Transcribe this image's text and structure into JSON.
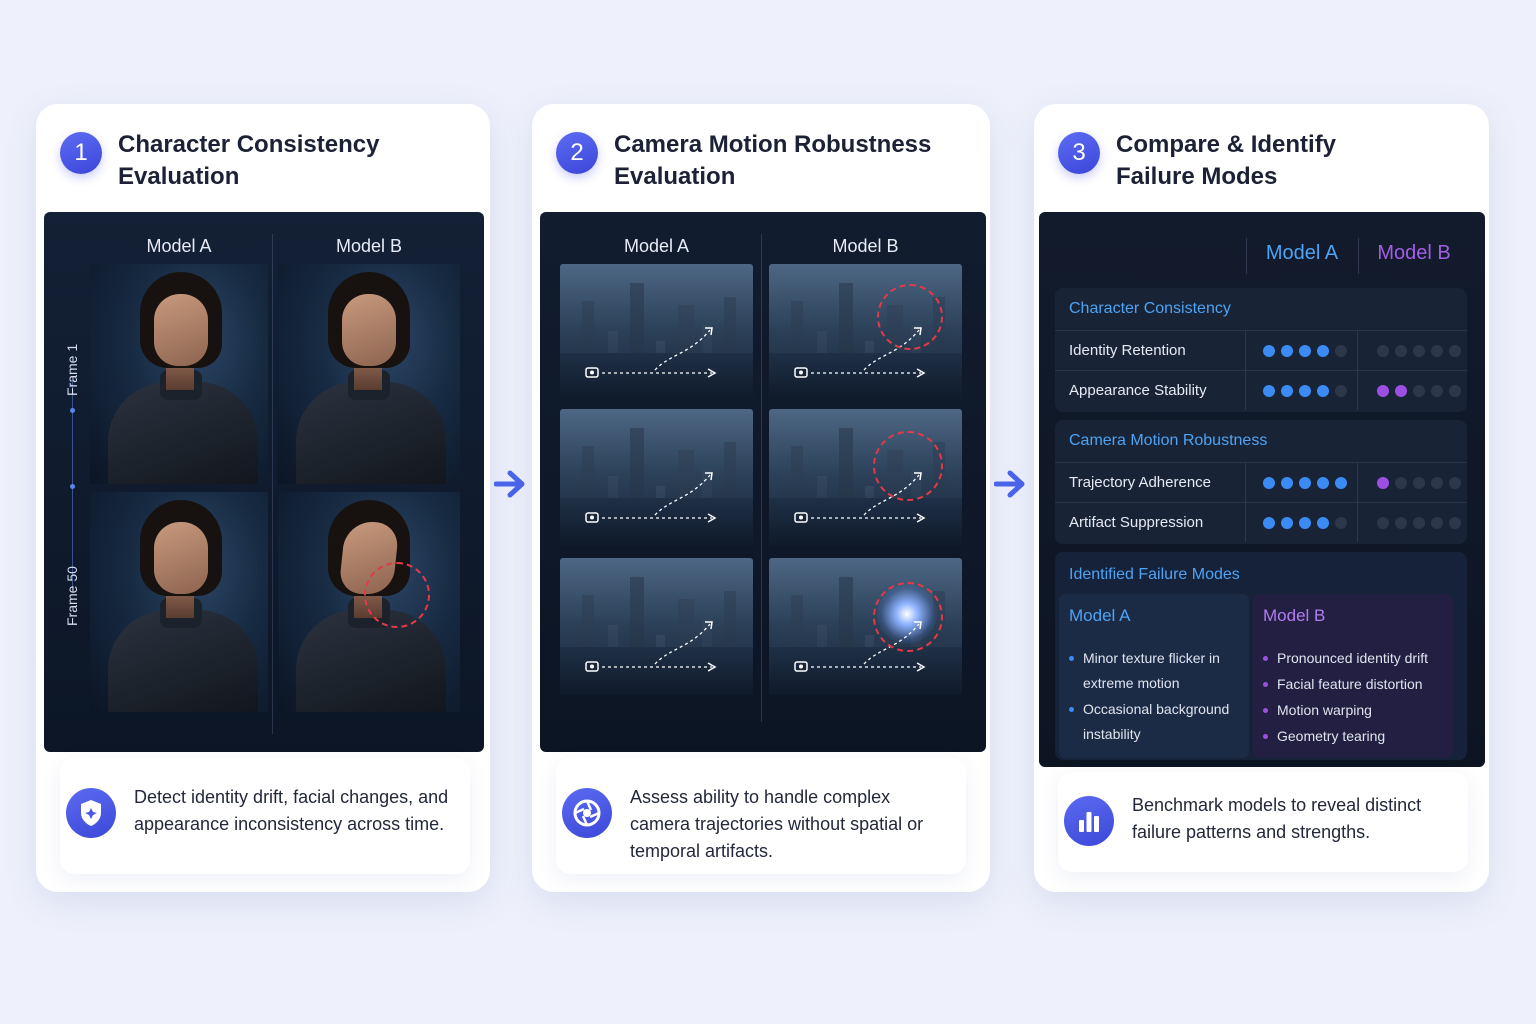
{
  "steps": [
    {
      "number": "1",
      "title": "Character Consistency\nEvaluation",
      "col_a": "Model A",
      "col_b": "Model B",
      "frame_top": "Frame 1",
      "frame_bottom": "Frame 50",
      "description": "Detect identity drift, facial changes, and appearance inconsistency across time.",
      "icon": "shield-icon"
    },
    {
      "number": "2",
      "title": "Camera Motion Robustness\nEvaluation",
      "col_a": "Model A",
      "col_b": "Model B",
      "description": "Assess ability to handle complex camera trajectories without spatial or temporal artifacts.",
      "icon": "aperture-icon"
    },
    {
      "number": "3",
      "title": "Compare & Identify\nFailure Modes",
      "description": "Benchmark models to reveal distinct failure patterns and strengths.",
      "icon": "bar-chart-icon"
    }
  ],
  "comparison": {
    "model_a": "Model A",
    "model_b": "Model B",
    "sections": [
      {
        "title": "Character Consistency",
        "metrics": [
          {
            "label": "Identity Retention",
            "model_a": 4,
            "model_b": 0
          },
          {
            "label": "Appearance Stability",
            "model_a": 4,
            "model_b": 2
          }
        ]
      },
      {
        "title": "Camera Motion Robustness",
        "metrics": [
          {
            "label": "Trajectory Adherence",
            "model_a": 5,
            "model_b": 1
          },
          {
            "label": "Artifact Suppression",
            "model_a": 4,
            "model_b": 0
          }
        ]
      }
    ],
    "max_score": 5,
    "failure_modes": {
      "title": "Identified Failure Modes",
      "model_a": {
        "title": "Model A",
        "items": [
          "Minor texture flicker in extreme motion",
          "Occasional background instability"
        ]
      },
      "model_b": {
        "title": "Model B",
        "items": [
          "Pronounced identity drift",
          "Facial feature distortion",
          "Motion warping",
          "Geometry tearing"
        ]
      }
    }
  },
  "colors": {
    "accent": "#4a56e6",
    "model_a": "#3b8bf4",
    "model_b": "#9e4fe3",
    "artifact": "#e23a48",
    "panel_dark": "#0f1a2b"
  }
}
